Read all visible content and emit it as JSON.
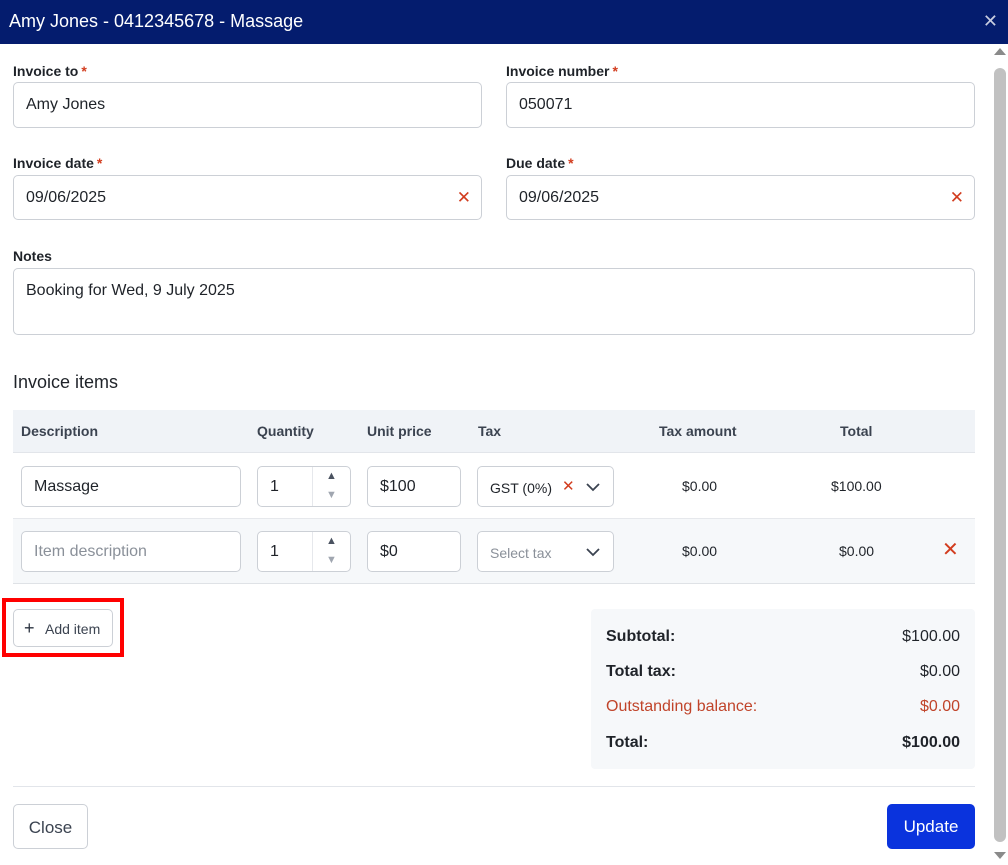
{
  "window": {
    "title": "Amy Jones - 0412345678 - Massage",
    "close_glyph": "✕"
  },
  "form": {
    "invoice_to": {
      "label": "Invoice to",
      "required": "*",
      "value": "Amy Jones"
    },
    "invoice_number": {
      "label": "Invoice number",
      "required": "*",
      "value": "050071"
    },
    "invoice_date": {
      "label": "Invoice date",
      "required": "*",
      "value": "09/06/2025",
      "clear_glyph": "✕"
    },
    "due_date": {
      "label": "Due date",
      "required": "*",
      "value": "09/06/2025",
      "clear_glyph": "✕"
    },
    "notes": {
      "label": "Notes",
      "value": "Booking for Wed, 9 July 2025"
    }
  },
  "items_section": {
    "title": "Invoice items",
    "columns": [
      "Description",
      "Quantity",
      "Unit price",
      "Tax",
      "Tax amount",
      "Total"
    ],
    "rows": [
      {
        "description": "Massage",
        "quantity": "1",
        "unit_price": "$100",
        "tax": "GST (0%)",
        "tax_amount": "$0.00",
        "total": "$100.00"
      },
      {
        "description_placeholder": "Item description",
        "quantity": "1",
        "unit_price": "$0",
        "tax_placeholder": "Select tax",
        "tax_amount": "$0.00",
        "total": "$0.00"
      }
    ],
    "stepper_up": "▲",
    "stepper_down": "▼",
    "tax_clear_glyph": "✕",
    "remove_glyph": "✕",
    "add_item": {
      "plus": "+",
      "label": "Add item"
    }
  },
  "totals": {
    "subtotal": {
      "label": "Subtotal:",
      "value": "$100.00"
    },
    "total_tax": {
      "label": "Total tax:",
      "value": "$0.00"
    },
    "outstanding": {
      "label": "Outstanding balance:",
      "value": "$0.00"
    },
    "total": {
      "label": "Total:",
      "value": "$100.00"
    }
  },
  "footer": {
    "close_label": "Close",
    "update_label": "Update"
  },
  "colors": {
    "titlebar": "#041c6e",
    "required": "#d23c1e",
    "primary_button": "#0a33dd",
    "warning_text": "#c0442a",
    "highlight": "#ff0000"
  }
}
